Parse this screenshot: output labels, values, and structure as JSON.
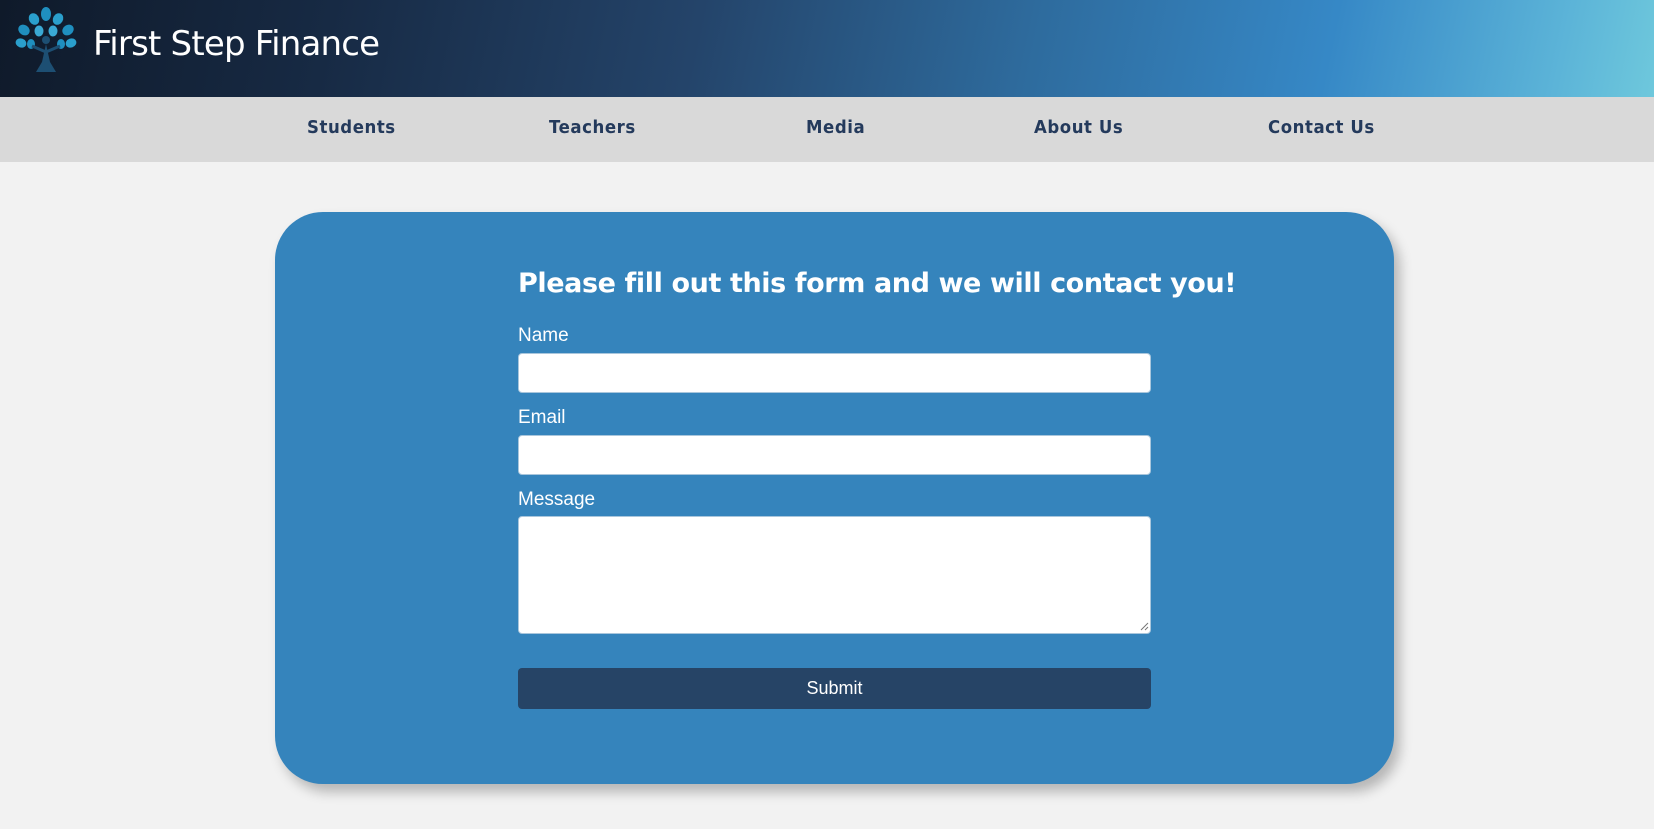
{
  "header": {
    "brand": "First Step Finance",
    "logo_icon": "tree-icon"
  },
  "nav": {
    "items": [
      {
        "label": "Students"
      },
      {
        "label": "Teachers"
      },
      {
        "label": "Media"
      },
      {
        "label": "About Us"
      },
      {
        "label": "Contact Us"
      }
    ]
  },
  "form": {
    "title": "Please fill out this form and we will contact you!",
    "name_label": "Name",
    "name_value": "",
    "email_label": "Email",
    "email_value": "",
    "message_label": "Message",
    "message_value": "",
    "submit_label": "Submit"
  },
  "colors": {
    "nav_text": "#243a5c",
    "card": "#3584bc",
    "submit": "#264466"
  }
}
